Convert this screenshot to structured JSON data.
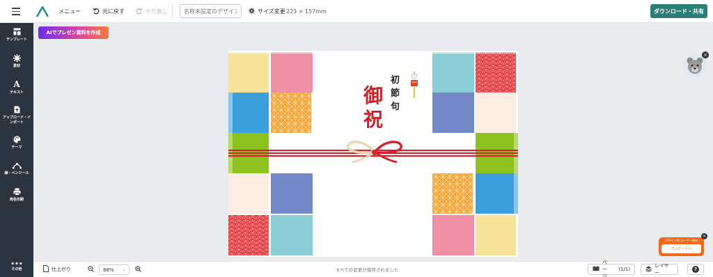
{
  "header": {
    "menu_label": "メニュー",
    "undo_label": "元に戻す",
    "redo_label": "やり直し",
    "design_name_placeholder": "名称未設定のデザイン",
    "resize_label": "サイズ変更",
    "dimensions": "223 × 157mm",
    "download_label": "ダウンロード・共有"
  },
  "sidebar": {
    "items": [
      {
        "label": "テンプレート",
        "icon": "template-icon"
      },
      {
        "label": "素材",
        "icon": "elements-icon"
      },
      {
        "label": "テキスト",
        "icon": "text-icon"
      },
      {
        "label": "アップロード・インポート",
        "icon": "upload-icon"
      },
      {
        "label": "テーマ",
        "icon": "palette-icon"
      },
      {
        "label": "線・ペンツール",
        "icon": "pen-tool-icon"
      },
      {
        "label": "宛名印刷",
        "icon": "printer-icon"
      },
      {
        "label": "その他",
        "icon": "more-icon"
      }
    ]
  },
  "ai_button_label": "AIでプレゼン資料を作成",
  "design": {
    "title_small": "初節句",
    "title_large": "御祝",
    "colors": {
      "yellow": "#f7e29c",
      "pink": "#ee8fa6",
      "blue": "#3b9fdb",
      "orange": "#f2a338",
      "green": "#8ec21f",
      "cream": "#fbece4",
      "periwinkle": "#7288c7",
      "teal": "#8cced6",
      "red": "#e53a3f",
      "ribbon": "#d3232e"
    }
  },
  "footer": {
    "finish_label": "仕上がり",
    "zoom_value": "88%",
    "saved_status": "すべての変更が保存されました",
    "page_label": "ページ",
    "page_count": "(1/1)",
    "layer_label": "レイヤー",
    "help_label": "?"
  },
  "survey": {
    "title": "デザインACユーザー様向",
    "button_label": "アンケートへ"
  }
}
